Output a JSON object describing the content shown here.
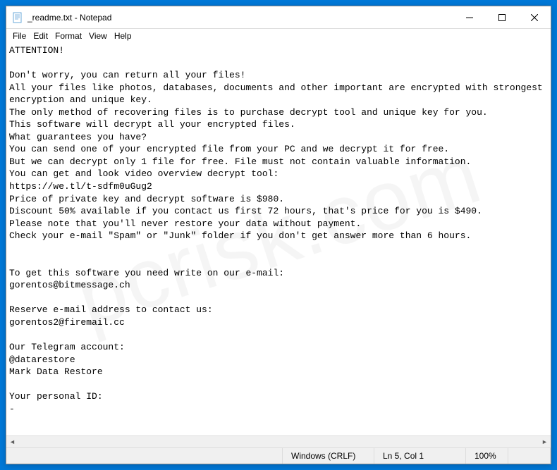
{
  "titlebar": {
    "title": "_readme.txt - Notepad"
  },
  "menubar": {
    "items": [
      "File",
      "Edit",
      "Format",
      "View",
      "Help"
    ]
  },
  "content": {
    "text": "ATTENTION!\n\nDon't worry, you can return all your files!\nAll your files like photos, databases, documents and other important are encrypted with strongest encryption and unique key.\nThe only method of recovering files is to purchase decrypt tool and unique key for you.\nThis software will decrypt all your encrypted files.\nWhat guarantees you have?\nYou can send one of your encrypted file from your PC and we decrypt it for free.\nBut we can decrypt only 1 file for free. File must not contain valuable information.\nYou can get and look video overview decrypt tool:\nhttps://we.tl/t-sdfm0uGug2\nPrice of private key and decrypt software is $980.\nDiscount 50% available if you contact us first 72 hours, that's price for you is $490.\nPlease note that you'll never restore your data without payment.\nCheck your e-mail \"Spam\" or \"Junk\" folder if you don't get answer more than 6 hours.\n\n\nTo get this software you need write on our e-mail:\ngorentos@bitmessage.ch\n\nReserve e-mail address to contact us:\ngorentos2@firemail.cc\n\nOur Telegram account:\n@datarestore\nMark Data Restore\n\nYour personal ID:\n-"
  },
  "statusbar": {
    "encoding": "Windows (CRLF)",
    "position": "Ln 5, Col 1",
    "zoom": "100%"
  },
  "watermark": "pcrisk.com"
}
